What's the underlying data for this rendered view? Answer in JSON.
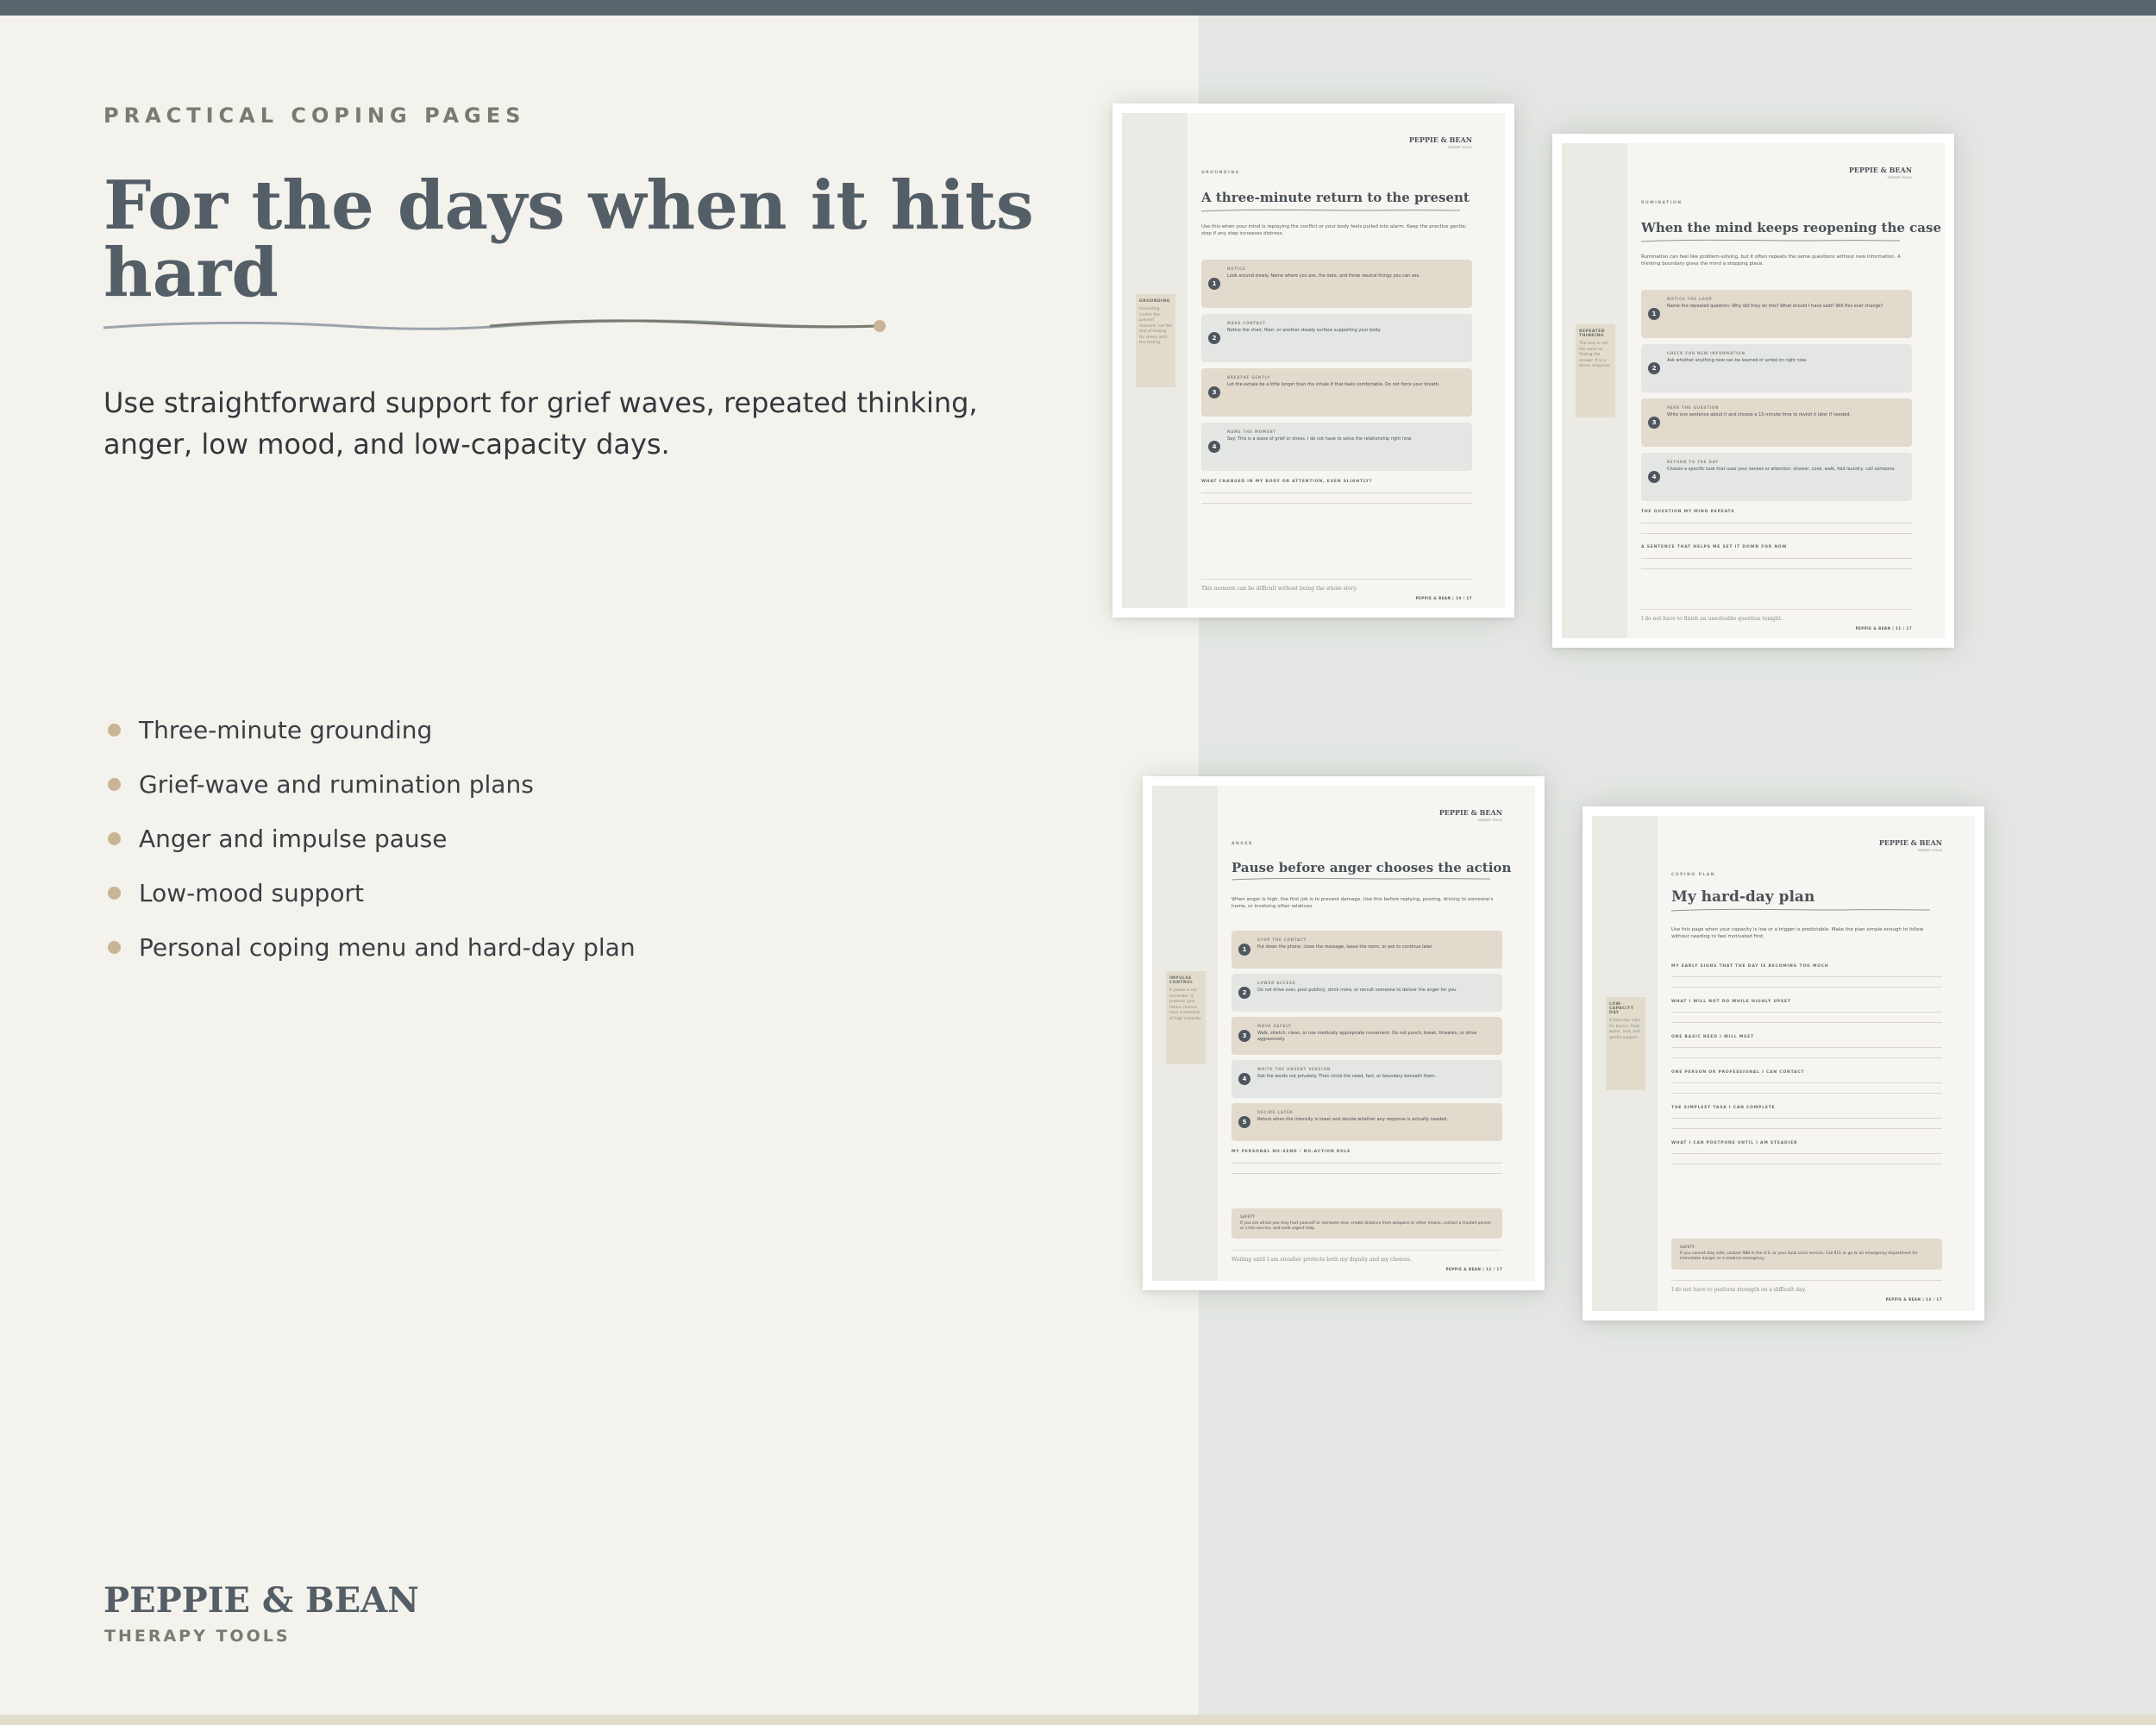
{
  "hero": {
    "eyebrow": "PRACTICAL COPING PAGES",
    "headline": "For the days when it hits hard",
    "intro": "Use straightforward support for grief waves, repeated thinking, anger, low mood, and low-capacity days.",
    "bullets": [
      "Three-minute grounding",
      "Grief-wave and rumination plans",
      "Anger and impulse pause",
      "Low-mood support",
      "Personal coping menu and hard-day plan"
    ]
  },
  "brand": {
    "name": "PEPPIE & BEAN",
    "tagline": "THERAPY TOOLS"
  },
  "colors": {
    "background": "#f4f2ec",
    "panel": "#e3e6e2",
    "topbar": "#5a646c",
    "headline": "#535e66",
    "accent_tan": "#c9b596",
    "card_tan": "#e2dacc",
    "card_gray": "#e3e6e3"
  },
  "sheets": [
    {
      "logo": "PEPPIE & BEAN",
      "logo_sub": "THERAPY TOOLS",
      "kicker": "GROUNDING",
      "title": "A three-minute return to the present",
      "intro": "Use this when your mind is replaying the conflict or your body feels pulled into alarm. Keep the practice gentle; stop if any step increases distress.",
      "rail_title": "GROUNDING",
      "rail_text": "Grounding invites the present moment, not the end of feeling. Go slowly with the feeling.",
      "steps": [
        {
          "n": "1",
          "label": "NOTICE",
          "text": "Look around slowly. Name where you are, the date, and three neutral things you can see."
        },
        {
          "n": "2",
          "label": "MAKE CONTACT",
          "text": "Notice the chair, floor, or another steady surface supporting your body."
        },
        {
          "n": "3",
          "label": "BREATHE GENTLY",
          "text": "Let the exhale be a little longer than the inhale if that feels comfortable. Do not force your breath."
        },
        {
          "n": "4",
          "label": "NAME THE MOMENT",
          "text": "Say: This is a wave of grief or stress. I do not have to solve the relationship right now."
        }
      ],
      "questions": [
        "WHAT CHANGED IN MY BODY OR ATTENTION, EVEN SLIGHTLY?"
      ],
      "footer": "This moment can be difficult without being the whole story.",
      "page": "PEPPIE & BEAN | 10 / 17"
    },
    {
      "logo": "PEPPIE & BEAN",
      "logo_sub": "THERAPY TOOLS",
      "kicker": "RUMINATION",
      "title": "When the mind keeps reopening the case",
      "intro": "Rumination can feel like problem-solving, but it often repeats the same questions without new information. A thinking boundary gives the mind a stopping place.",
      "rail_title": "REPEATED THINKING",
      "rail_text": "The loop is not the same as finding the answer. It is a stress response.",
      "steps": [
        {
          "n": "1",
          "label": "NOTICE THE LOOP",
          "text": "Name the repeated question: Why did they do this? What should I have said? Will this ever change?"
        },
        {
          "n": "2",
          "label": "CHECK FOR NEW INFORMATION",
          "text": "Ask whether anything new can be learned or acted on right now."
        },
        {
          "n": "3",
          "label": "PARK THE QUESTION",
          "text": "Write one sentence about it and choose a 15-minute time to revisit it later if needed."
        },
        {
          "n": "4",
          "label": "RETURN TO THE DAY",
          "text": "Choose a specific task that uses your senses or attention: shower, cook, walk, fold laundry, call someone."
        }
      ],
      "questions": [
        "THE QUESTION MY MIND REPEATS",
        "A SENTENCE THAT HELPS ME SET IT DOWN FOR NOW"
      ],
      "footer": "I do not have to finish an unsolvable question tonight.",
      "page": "PEPPIE & BEAN | 11 / 17"
    },
    {
      "logo": "PEPPIE & BEAN",
      "logo_sub": "THERAPY TOOLS",
      "kicker": "ANGER",
      "title": "Pause before anger chooses the action",
      "intro": "When anger is high, the first job is to prevent damage. Use this before replying, posting, driving to someone's home, or involving other relatives.",
      "rail_title": "IMPULSE CONTROL",
      "rail_text": "A pause is not surrender. It protects your future choices from a moment of high intensity.",
      "steps": [
        {
          "n": "1",
          "label": "STOP THE CONTACT",
          "text": "Put down the phone, close the message, leave the room, or ask to continue later."
        },
        {
          "n": "2",
          "label": "LOWER ACCESS",
          "text": "Do not drive over, post publicly, drink more, or recruit someone to deliver the anger for you."
        },
        {
          "n": "3",
          "label": "MOVE SAFELY",
          "text": "Walk, stretch, clean, or use medically appropriate movement. Do not punch, break, threaten, or drive aggressively."
        },
        {
          "n": "4",
          "label": "WRITE THE UNSENT VERSION",
          "text": "Get the words out privately. Then circle the need, fact, or boundary beneath them."
        },
        {
          "n": "5",
          "label": "DECIDE LATER",
          "text": "Return when the intensity is lower and decide whether any response is actually needed."
        }
      ],
      "questions": [
        "MY PERSONAL NO-SEND / NO-ACTION RULE"
      ],
      "safety_title": "SAFETY",
      "safety_text": "If you are afraid you may hurt yourself or someone else, create distance from weapons or other means, contact a trusted person or crisis service, and seek urgent help.",
      "footer": "Waiting until I am steadier protects both my dignity and my choices.",
      "page": "PEPPIE & BEAN | 12 / 17"
    },
    {
      "logo": "PEPPIE & BEAN",
      "logo_sub": "THERAPY TOOLS",
      "kicker": "COPING PLAN",
      "title": "My hard-day plan",
      "intro": "Use this page when your capacity is low or a trigger is predictable. Make the plan simple enough to follow without needing to feel motivated first.",
      "rail_title": "LOW-CAPACITY DAY",
      "rail_text": "A hard day calls for basics: food, water, rest, and gentle support.",
      "questions": [
        "MY EARLY SIGNS THAT THE DAY IS BECOMING TOO MUCH",
        "WHAT I WILL NOT DO WHILE HIGHLY UPSET",
        "ONE BASIC NEED I WILL MEET",
        "ONE PERSON OR PROFESSIONAL I CAN CONTACT",
        "THE SIMPLEST TASK I CAN COMPLETE",
        "WHAT I CAN POSTPONE UNTIL I AM STEADIER"
      ],
      "safety_title": "SAFETY",
      "safety_text": "If you cannot stay safe, contact 988 in the U.S. or your local crisis service. Call 911 or go to an emergency department for immediate danger or a medical emergency.",
      "footer": "I do not have to perform strength on a difficult day.",
      "page": "PEPPIE & BEAN | 13 / 17"
    }
  ]
}
